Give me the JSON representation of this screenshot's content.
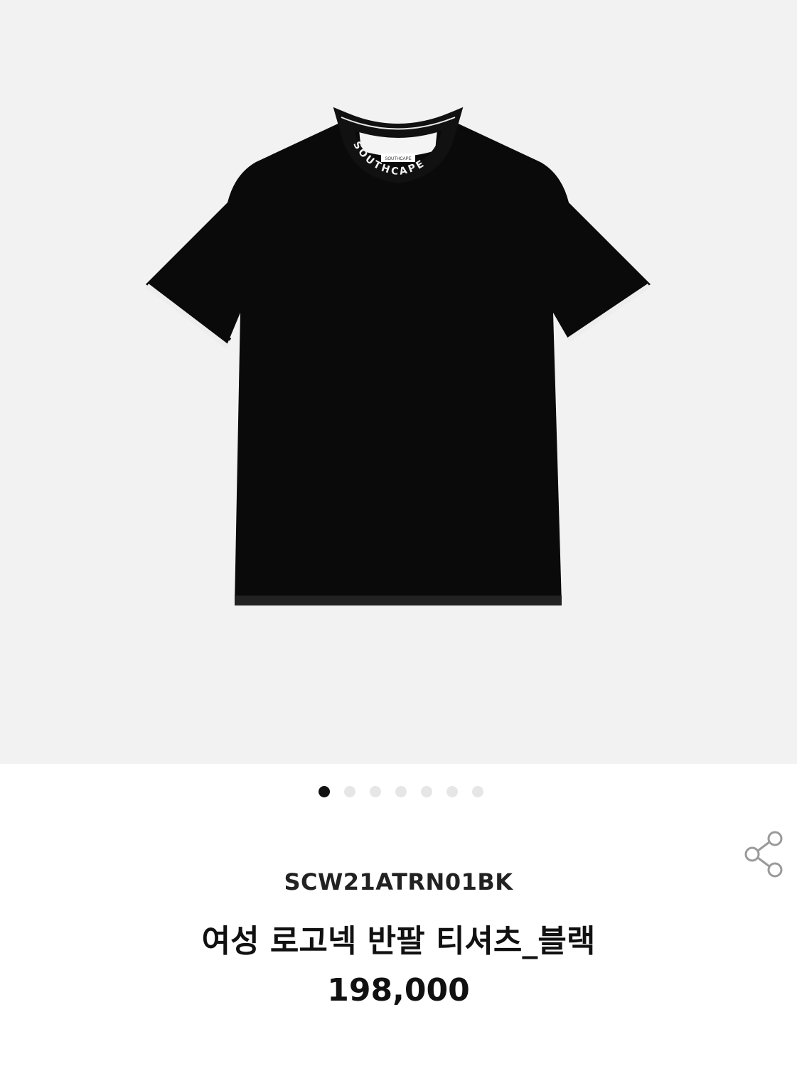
{
  "product": {
    "image_icon": "black-tshirt-image",
    "brand_collar_text": "SOUTHCAPE",
    "brand_label_text": "SOUTHCAPE",
    "carousel": {
      "total": 7,
      "active_index": 0
    },
    "share_icon": "share-icon",
    "code": "SCW21ATRN01BK",
    "name": "여성 로고넥 반팔 티셔츠_블랙",
    "price": "198,000"
  },
  "colors": {
    "background": "#ffffff",
    "hero_background": "#f2f2f2",
    "shirt": "#0a0a0a",
    "dot_active": "#111111",
    "dot_inactive": "#e6e6e6",
    "text": "#111111"
  }
}
